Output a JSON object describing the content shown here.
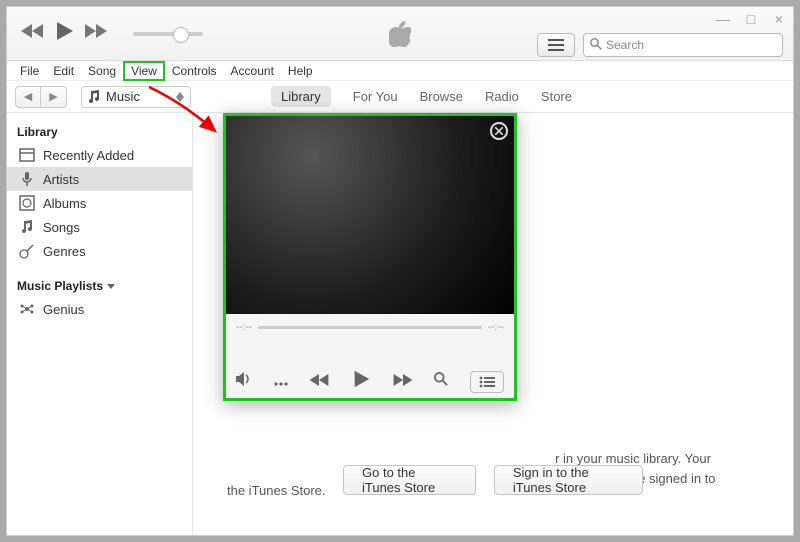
{
  "window_controls": {
    "min": "—",
    "max": "□",
    "close": "×"
  },
  "search": {
    "placeholder": "Search"
  },
  "menubar": [
    "File",
    "Edit",
    "Song",
    "View",
    "Controls",
    "Account",
    "Help"
  ],
  "media_selector": {
    "label": "Music"
  },
  "tabs": {
    "library": "Library",
    "foryou": "For You",
    "browse": "Browse",
    "radio": "Radio",
    "store": "Store"
  },
  "sidebar": {
    "header1": "Library",
    "items": [
      {
        "label": "Recently Added"
      },
      {
        "label": "Artists"
      },
      {
        "label": "Albums"
      },
      {
        "label": "Songs"
      },
      {
        "label": "Genres"
      }
    ],
    "header2": "Music Playlists",
    "genius": "Genius"
  },
  "content": {
    "line1": "r in your music library. Your",
    "line2": "whenever you're signed in to",
    "line3": "the iTunes Store.",
    "btn_store": "Go to the iTunes Store",
    "btn_signin": "Sign in to the iTunes Store"
  },
  "miniplayer": {
    "time_l": "--:--",
    "time_r": "--:--"
  },
  "colors": {
    "highlight": "#21c221"
  }
}
